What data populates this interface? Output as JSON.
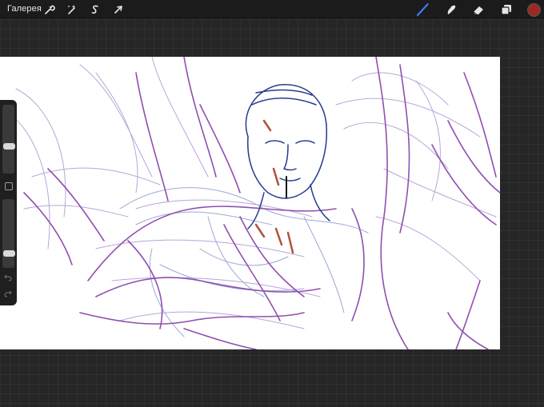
{
  "topbar": {
    "gallery_label": "Галерея",
    "left_tools": [
      {
        "icon": "wrench-icon",
        "name": "actions-button"
      },
      {
        "icon": "magic-wand-icon",
        "name": "adjustments-button"
      },
      {
        "icon": "selection-s-icon",
        "name": "selection-button"
      },
      {
        "icon": "arrow-cursor-icon",
        "name": "transform-button"
      }
    ],
    "right_tools": [
      {
        "icon": "brush-icon",
        "name": "brush-button",
        "active": true
      },
      {
        "icon": "smudge-icon",
        "name": "smudge-button"
      },
      {
        "icon": "eraser-icon",
        "name": "eraser-button"
      },
      {
        "icon": "layers-icon",
        "name": "layers-button"
      }
    ],
    "current_color": "#9b2a26",
    "accent_color": "#3d7bf5"
  },
  "sidebar": {
    "brush_size_level": 0.38,
    "opacity_level": 0.18,
    "icons": [
      "modify-square-icon",
      "undo-icon",
      "redo-icon"
    ]
  },
  "canvas": {
    "content": "sketch-artwork",
    "background": "#ffffff"
  }
}
